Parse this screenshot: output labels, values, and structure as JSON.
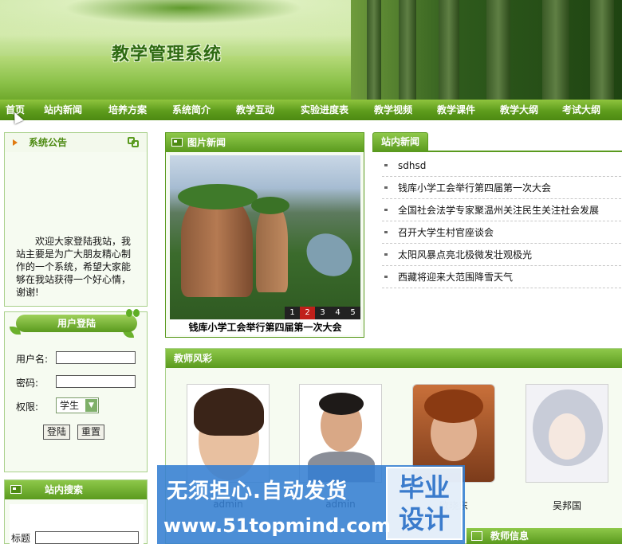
{
  "header": {
    "site_title": "教学管理系统"
  },
  "nav": {
    "items": [
      {
        "label": "首页",
        "w": 38
      },
      {
        "label": "站内新闻",
        "w": 82
      },
      {
        "label": "培养方案",
        "w": 80
      },
      {
        "label": "系统简介",
        "w": 80
      },
      {
        "label": "教学互动",
        "w": 80
      },
      {
        "label": "实验进度表",
        "w": 94
      },
      {
        "label": "教学视频",
        "w": 78
      },
      {
        "label": "教学课件",
        "w": 80
      },
      {
        "label": "教学大纲",
        "w": 78
      },
      {
        "label": "考试大纲",
        "w": 78
      }
    ]
  },
  "notice": {
    "title": "系统公告",
    "body": "欢迎大家登陆我站，我站主要是为广大朋友精心制作的一个系统，希望大家能够在我站获得一个好心情，谢谢!"
  },
  "login": {
    "title": "用户登陆",
    "username_label": "用户名:",
    "password_label": "密码:",
    "role_label": "权限:",
    "role_value": "学生",
    "login_button": "登陆",
    "reset_button": "重置"
  },
  "search": {
    "title": "站内搜索",
    "field_label": "标题"
  },
  "picnews": {
    "title": "图片新闻",
    "caption": "钱库小学工会举行第四届第一次大会",
    "pages": [
      "1",
      "2",
      "3",
      "4",
      "5"
    ],
    "active_page": "2"
  },
  "sitenews": {
    "title": "站内新闻",
    "items": [
      "sdhsd",
      "钱库小学工会举行第四届第一次大会",
      "全国社会法学专家聚温州关注民生关注社会发展",
      "召开大学生村官座谈会",
      "太阳风暴点亮北极微发壮观极光",
      "西藏将迎来大范围降雪天气"
    ]
  },
  "teachers": {
    "title": "教师风彩",
    "names": [
      "admin",
      "admin",
      "欧晓东",
      "吴邦国"
    ]
  },
  "ad": {
    "line1": "无须担心.自动发货",
    "line2": "www.51topmind.com",
    "box_line1": "毕业",
    "box_line2": "设计"
  },
  "teacher_info": {
    "title": "教师信息"
  },
  "colors": {
    "accent": "#5a9a1e",
    "nav": "#4d8a12",
    "ad": "#347ed2"
  }
}
